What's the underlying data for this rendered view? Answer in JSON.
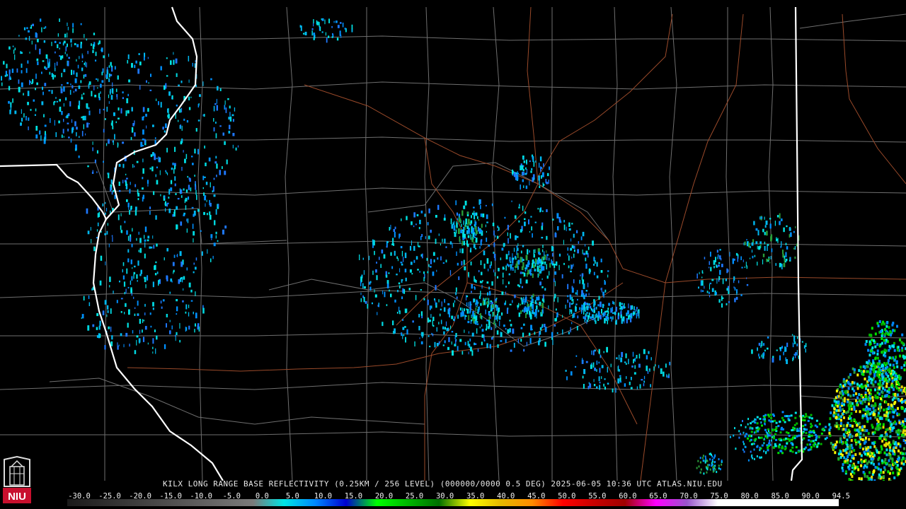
{
  "header": {
    "status_line": "KILX LONG RANGE BASE REFLECTIVITY (0.25KM / 256 LEVEL) (000000/0000 0.5 DEG) 2025-06-05 10:36 UTC  ATLAS.NIU.EDU"
  },
  "logo": {
    "text": "NIU",
    "color": "#c8102e"
  },
  "colorbar": {
    "ticks": [
      "-30.0",
      "-25.0",
      "-20.0",
      "-15.0",
      "-10.0",
      "-5.0",
      "0.0",
      "5.0",
      "10.0",
      "15.0",
      "20.0",
      "25.0",
      "30.0",
      "35.0",
      "40.0",
      "45.0",
      "50.0",
      "55.0",
      "60.0",
      "65.0",
      "70.0",
      "75.0",
      "80.0",
      "85.0",
      "90.0",
      "94.5"
    ],
    "stops": [
      {
        "dbz": -30,
        "color": "#1a1a1a"
      },
      {
        "dbz": 0,
        "color": "#7a7a7a"
      },
      {
        "dbz": 5,
        "color": "#00e5e5"
      },
      {
        "dbz": 10,
        "color": "#0088ff"
      },
      {
        "dbz": 15,
        "color": "#0000d0"
      },
      {
        "dbz": 20,
        "color": "#00ff00"
      },
      {
        "dbz": 25,
        "color": "#00b800"
      },
      {
        "dbz": 30,
        "color": "#007000"
      },
      {
        "dbz": 35,
        "color": "#ffff00"
      },
      {
        "dbz": 40,
        "color": "#e6b800"
      },
      {
        "dbz": 45,
        "color": "#ff8c00"
      },
      {
        "dbz": 50,
        "color": "#ff0000"
      },
      {
        "dbz": 55,
        "color": "#c80000"
      },
      {
        "dbz": 60,
        "color": "#a00000"
      },
      {
        "dbz": 65,
        "color": "#ff00ff"
      },
      {
        "dbz": 70,
        "color": "#9955cc"
      },
      {
        "dbz": 75,
        "color": "#ffffff"
      },
      {
        "dbz": 94.5,
        "color": "#ffffff"
      }
    ]
  },
  "map_colors": {
    "state_border": "#ffffff",
    "county_line": "#7a7a7a",
    "highway": "#a0522d",
    "background": "#000000"
  }
}
